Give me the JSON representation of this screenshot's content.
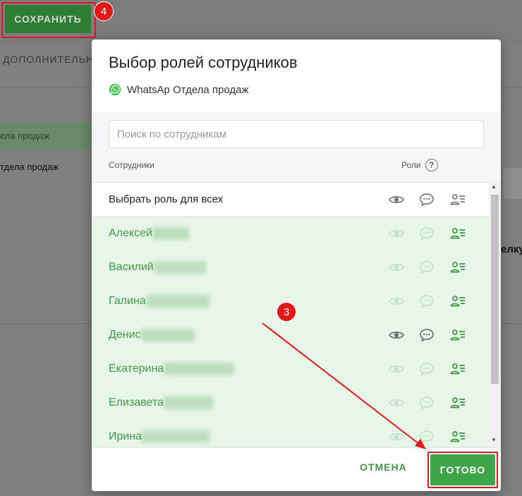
{
  "background": {
    "save_label": "СОХРАНИТЬ",
    "tab_label": "ДОПОЛНИТЕЛЬН",
    "item1": "ела продаж",
    "item2": "тдела продаж",
    "right_text": "елку"
  },
  "annotations": {
    "badge_save": "4",
    "badge_done": "3"
  },
  "modal": {
    "title": "Выбор ролей сотрудников",
    "channel": "WhatsAp Отдела продаж",
    "search_placeholder": "Поиск по сотрудникам",
    "col_staff": "Сотрудники",
    "col_roles": "Роли",
    "help_icon": "?",
    "select_all": "Выбрать роль для всех",
    "employees": [
      {
        "name": "Алексей",
        "eye": false,
        "chat": false,
        "role": true
      },
      {
        "name": "Василий",
        "eye": false,
        "chat": false,
        "role": true
      },
      {
        "name": "Галина",
        "eye": false,
        "chat": false,
        "role": true
      },
      {
        "name": "Денис",
        "eye": true,
        "chat": true,
        "role": true
      },
      {
        "name": "Екатерина",
        "eye": false,
        "chat": false,
        "role": true
      },
      {
        "name": "Елизавета",
        "eye": false,
        "chat": false,
        "role": true
      },
      {
        "name": "Ирина",
        "eye": false,
        "chat": false,
        "role": true
      }
    ],
    "cancel_label": "ОТМЕНА",
    "done_label": "ГОТОВО"
  },
  "icons": {
    "eye": "eye-icon",
    "chat": "chat-bubble-icon",
    "role": "user-role-icon",
    "whatsapp": "whatsapp-icon"
  },
  "colors": {
    "accent_green": "#3fa548",
    "name_green": "#3d9a41",
    "row_bg": "#e8f5e9",
    "annotation_red": "#e11818"
  }
}
